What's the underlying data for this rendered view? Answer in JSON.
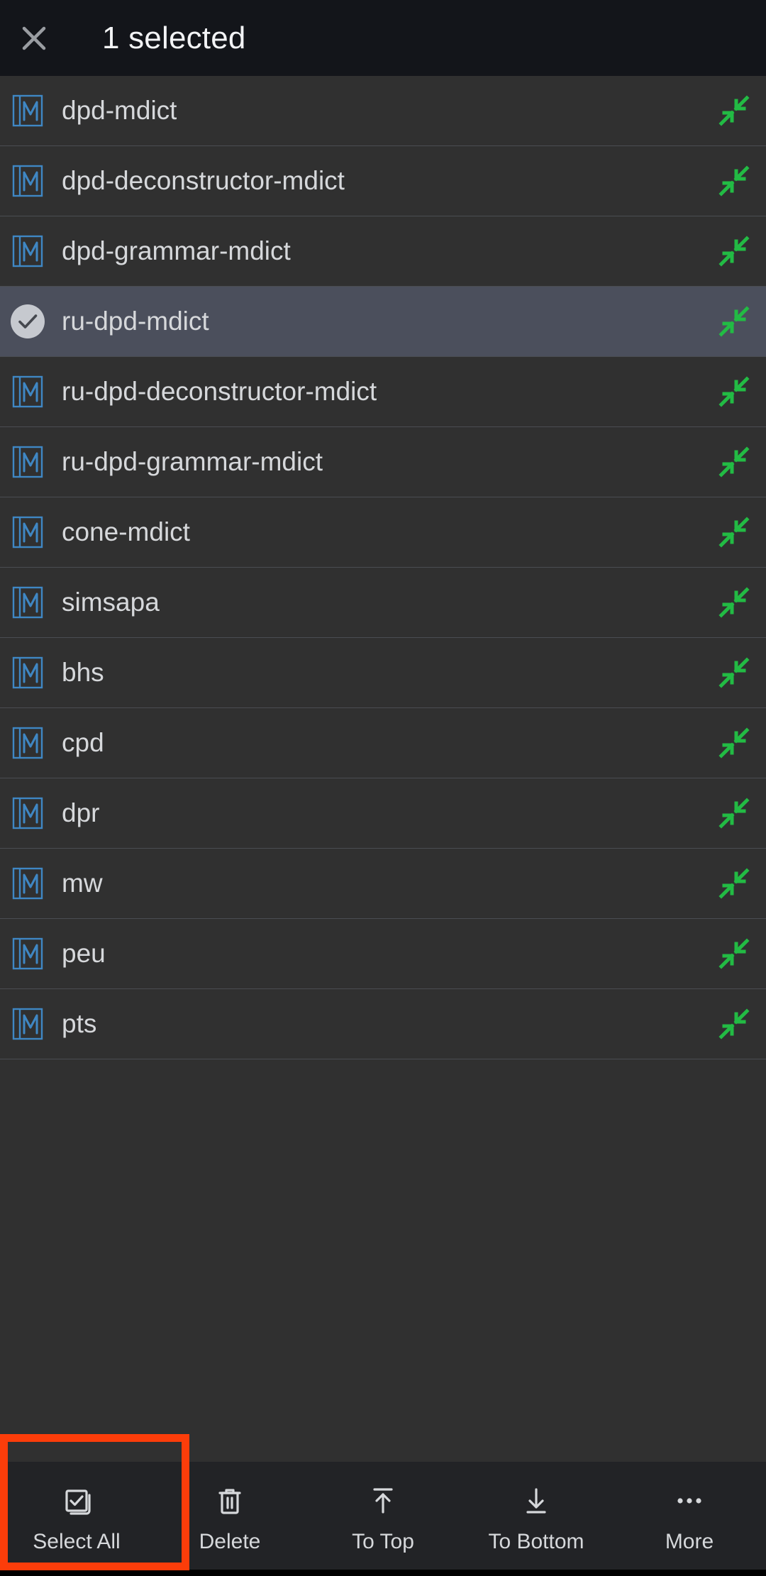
{
  "header": {
    "close_icon": "close-icon",
    "title": "1 selected"
  },
  "list": {
    "item_icon": "dictionary-book-icon",
    "selected_icon": "check-circle-icon",
    "action_icon": "collapse-arrows-icon",
    "items": [
      {
        "label": "dpd-mdict",
        "selected": false
      },
      {
        "label": "dpd-deconstructor-mdict",
        "selected": false
      },
      {
        "label": "dpd-grammar-mdict",
        "selected": false
      },
      {
        "label": "ru-dpd-mdict",
        "selected": true
      },
      {
        "label": "ru-dpd-deconstructor-mdict",
        "selected": false
      },
      {
        "label": "ru-dpd-grammar-mdict",
        "selected": false
      },
      {
        "label": "cone-mdict",
        "selected": false
      },
      {
        "label": "simsapa",
        "selected": false
      },
      {
        "label": "bhs",
        "selected": false
      },
      {
        "label": "cpd",
        "selected": false
      },
      {
        "label": "dpr",
        "selected": false
      },
      {
        "label": "mw",
        "selected": false
      },
      {
        "label": "peu",
        "selected": false
      },
      {
        "label": "pts",
        "selected": false
      }
    ]
  },
  "toolbar": {
    "items": [
      {
        "label": "Select All",
        "icon": "select-all-icon"
      },
      {
        "label": "Delete",
        "icon": "trash-icon"
      },
      {
        "label": "To Top",
        "icon": "arrow-to-top-icon"
      },
      {
        "label": "To Bottom",
        "icon": "arrow-to-bottom-icon"
      },
      {
        "label": "More",
        "icon": "more-horizontal-icon"
      }
    ]
  },
  "annotation": {
    "highlight_color": "#fc3d0a",
    "target": "Select All"
  },
  "colors": {
    "header_bg": "#13151a",
    "list_bg": "#303030",
    "selected_row_bg": "#4b4f5c",
    "toolbar_bg": "#222326",
    "icon_blue": "#3f87c4",
    "action_green": "#22bb44",
    "text": "#d6d8db"
  }
}
